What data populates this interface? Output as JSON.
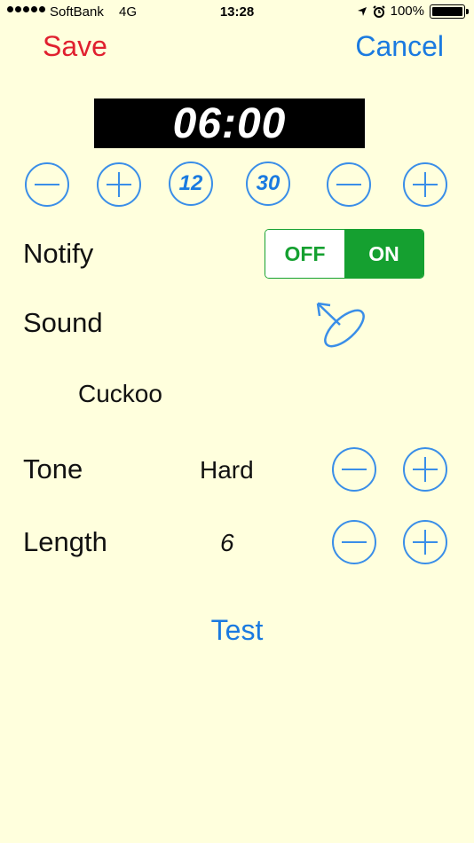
{
  "status_bar": {
    "carrier": "SoftBank",
    "network": "4G",
    "time": "13:28",
    "battery": "100%"
  },
  "nav": {
    "save_label": "Save",
    "cancel_label": "Cancel"
  },
  "clock": {
    "time": "06:00"
  },
  "time_controls": {
    "hour_preset": "12",
    "minute_preset": "30"
  },
  "notify": {
    "label": "Notify",
    "off_label": "OFF",
    "on_label": "ON",
    "state": "ON"
  },
  "sound": {
    "label": "Sound",
    "name": "Cuckoo"
  },
  "tone": {
    "label": "Tone",
    "value": "Hard"
  },
  "length": {
    "label": "Length",
    "value": "6"
  },
  "test_label": "Test",
  "colors": {
    "background": "#ffffdd",
    "accent_blue": "#1a7ae0",
    "save_red": "#e0202f",
    "toggle_green": "#15a030"
  },
  "icons": {
    "minus": "minus-icon",
    "plus": "plus-icon",
    "sound_picker": "antenna-dish-icon"
  }
}
